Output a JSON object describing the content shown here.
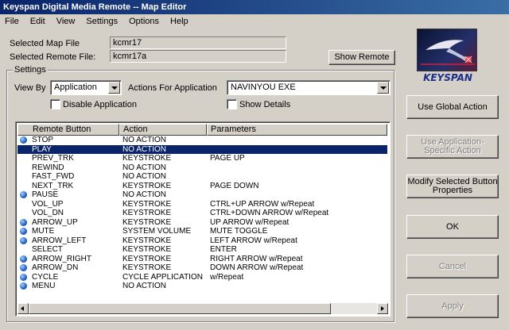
{
  "window": {
    "title": "Keyspan Digital Media Remote -- Map Editor"
  },
  "menu": [
    "File",
    "Edit",
    "View",
    "Settings",
    "Options",
    "Help"
  ],
  "selected_map_file": {
    "label": "Selected Map File",
    "value": "kcmr17"
  },
  "selected_remote_file": {
    "label": "Selected Remote File:",
    "value": "kcmr17a"
  },
  "show_remote_button": "Show Remote",
  "settings": {
    "group_title": "Settings",
    "view_by_label": "View By",
    "view_by_value": "Application",
    "actions_for_label": "Actions For  Application",
    "application_value": "NAVINYOU EXE",
    "disable_application": "Disable Application",
    "show_details": "Show Details"
  },
  "table": {
    "columns": [
      "Remote Button",
      "Action",
      "Parameters"
    ],
    "rows": [
      {
        "button": "STOP",
        "action": "NO ACTION",
        "params": "",
        "icon": true,
        "selected": false
      },
      {
        "button": "PLAY",
        "action": "NO ACTION",
        "params": "",
        "icon": false,
        "selected": true
      },
      {
        "button": "PREV_TRK",
        "action": "KEYSTROKE",
        "params": "PAGE UP",
        "icon": false,
        "selected": false
      },
      {
        "button": "REWIND",
        "action": "NO ACTION",
        "params": "",
        "icon": false,
        "selected": false
      },
      {
        "button": "FAST_FWD",
        "action": "NO ACTION",
        "params": "",
        "icon": false,
        "selected": false
      },
      {
        "button": "NEXT_TRK",
        "action": "KEYSTROKE",
        "params": "PAGE DOWN",
        "icon": false,
        "selected": false
      },
      {
        "button": "PAUSE",
        "action": "NO ACTION",
        "params": "",
        "icon": true,
        "selected": false
      },
      {
        "button": "VOL_UP",
        "action": "KEYSTROKE",
        "params": "CTRL+UP ARROW w/Repeat",
        "icon": false,
        "selected": false
      },
      {
        "button": "VOL_DN",
        "action": "KEYSTROKE",
        "params": "CTRL+DOWN ARROW w/Repeat",
        "icon": false,
        "selected": false
      },
      {
        "button": "ARROW_UP",
        "action": "KEYSTROKE",
        "params": "UP ARROW w/Repeat",
        "icon": true,
        "selected": false
      },
      {
        "button": "MUTE",
        "action": "SYSTEM VOLUME",
        "params": "MUTE TOGGLE",
        "icon": true,
        "selected": false
      },
      {
        "button": "ARROW_LEFT",
        "action": "KEYSTROKE",
        "params": "LEFT ARROW w/Repeat",
        "icon": true,
        "selected": false
      },
      {
        "button": "SELECT",
        "action": "KEYSTROKE",
        "params": "ENTER",
        "icon": false,
        "selected": false
      },
      {
        "button": "ARROW_RIGHT",
        "action": "KEYSTROKE",
        "params": "RIGHT ARROW w/Repeat",
        "icon": true,
        "selected": false
      },
      {
        "button": "ARROW_DN",
        "action": "KEYSTROKE",
        "params": "DOWN ARROW w/Repeat",
        "icon": true,
        "selected": false
      },
      {
        "button": "CYCLE",
        "action": "CYCLE APPLICATION",
        "params": "w/Repeat",
        "icon": true,
        "selected": false
      },
      {
        "button": "MENU",
        "action": "NO ACTION",
        "params": "",
        "icon": true,
        "selected": false
      }
    ]
  },
  "buttons": {
    "use_global_action": "Use Global Action",
    "use_application_specific_action": "Use Application-Specific Action",
    "modify_selected_button_properties": "Modify Selected Button Properties",
    "ok": "OK",
    "cancel": "Cancel",
    "apply": "Apply"
  },
  "logo": {
    "text": "KEYSPAN"
  }
}
